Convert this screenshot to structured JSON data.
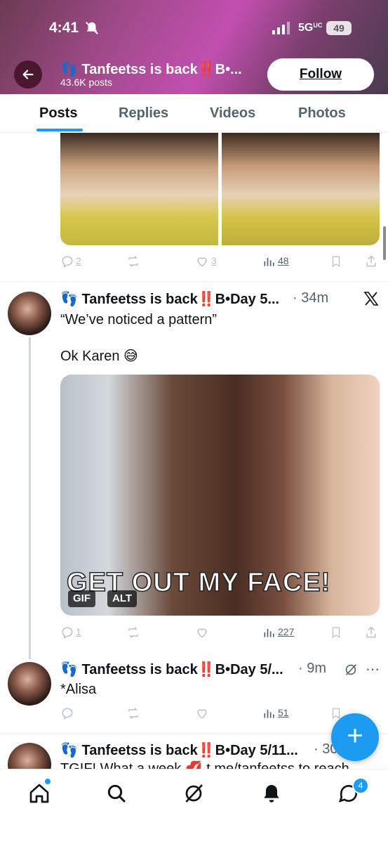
{
  "status_bar": {
    "time": "4:41",
    "network": "5G",
    "network_sup": "UC",
    "battery": "49"
  },
  "header": {
    "name": "👣 Tanfeetss is back‼️B•...",
    "posts_count": "43.6K posts",
    "follow_label": "Follow"
  },
  "tabs": [
    "Posts",
    "Replies",
    "Videos",
    "Photos"
  ],
  "top_post_actions": {
    "replies": "2",
    "likes": "3",
    "views": "48"
  },
  "tweets": [
    {
      "name": "👣 Tanfeetss is back‼️B•Day 5...",
      "time": "· 34m",
      "text": "“We’ve noticed a pattern”\n\nOk Karen 😅",
      "gif_caption": "GET OUT MY FACE!",
      "gif_badge": "GIF",
      "alt_badge": "ALT",
      "replies": "1",
      "views": "227"
    },
    {
      "name": "👣 Tanfeetss is back‼️B•Day 5/...",
      "time": "· 9m",
      "text": "*Alisa",
      "views": "51"
    },
    {
      "name": "👣 Tanfeetss is back‼️B•Day 5/11...",
      "time": "· 30",
      "text": "TGIF! What a week 💋 t.me/tanfeetss to reach"
    }
  ],
  "fab_label": "+",
  "messages_badge": "4",
  "colors": {
    "accent": "#1d9bf0",
    "text": "#0f1419",
    "muted": "#536471"
  }
}
